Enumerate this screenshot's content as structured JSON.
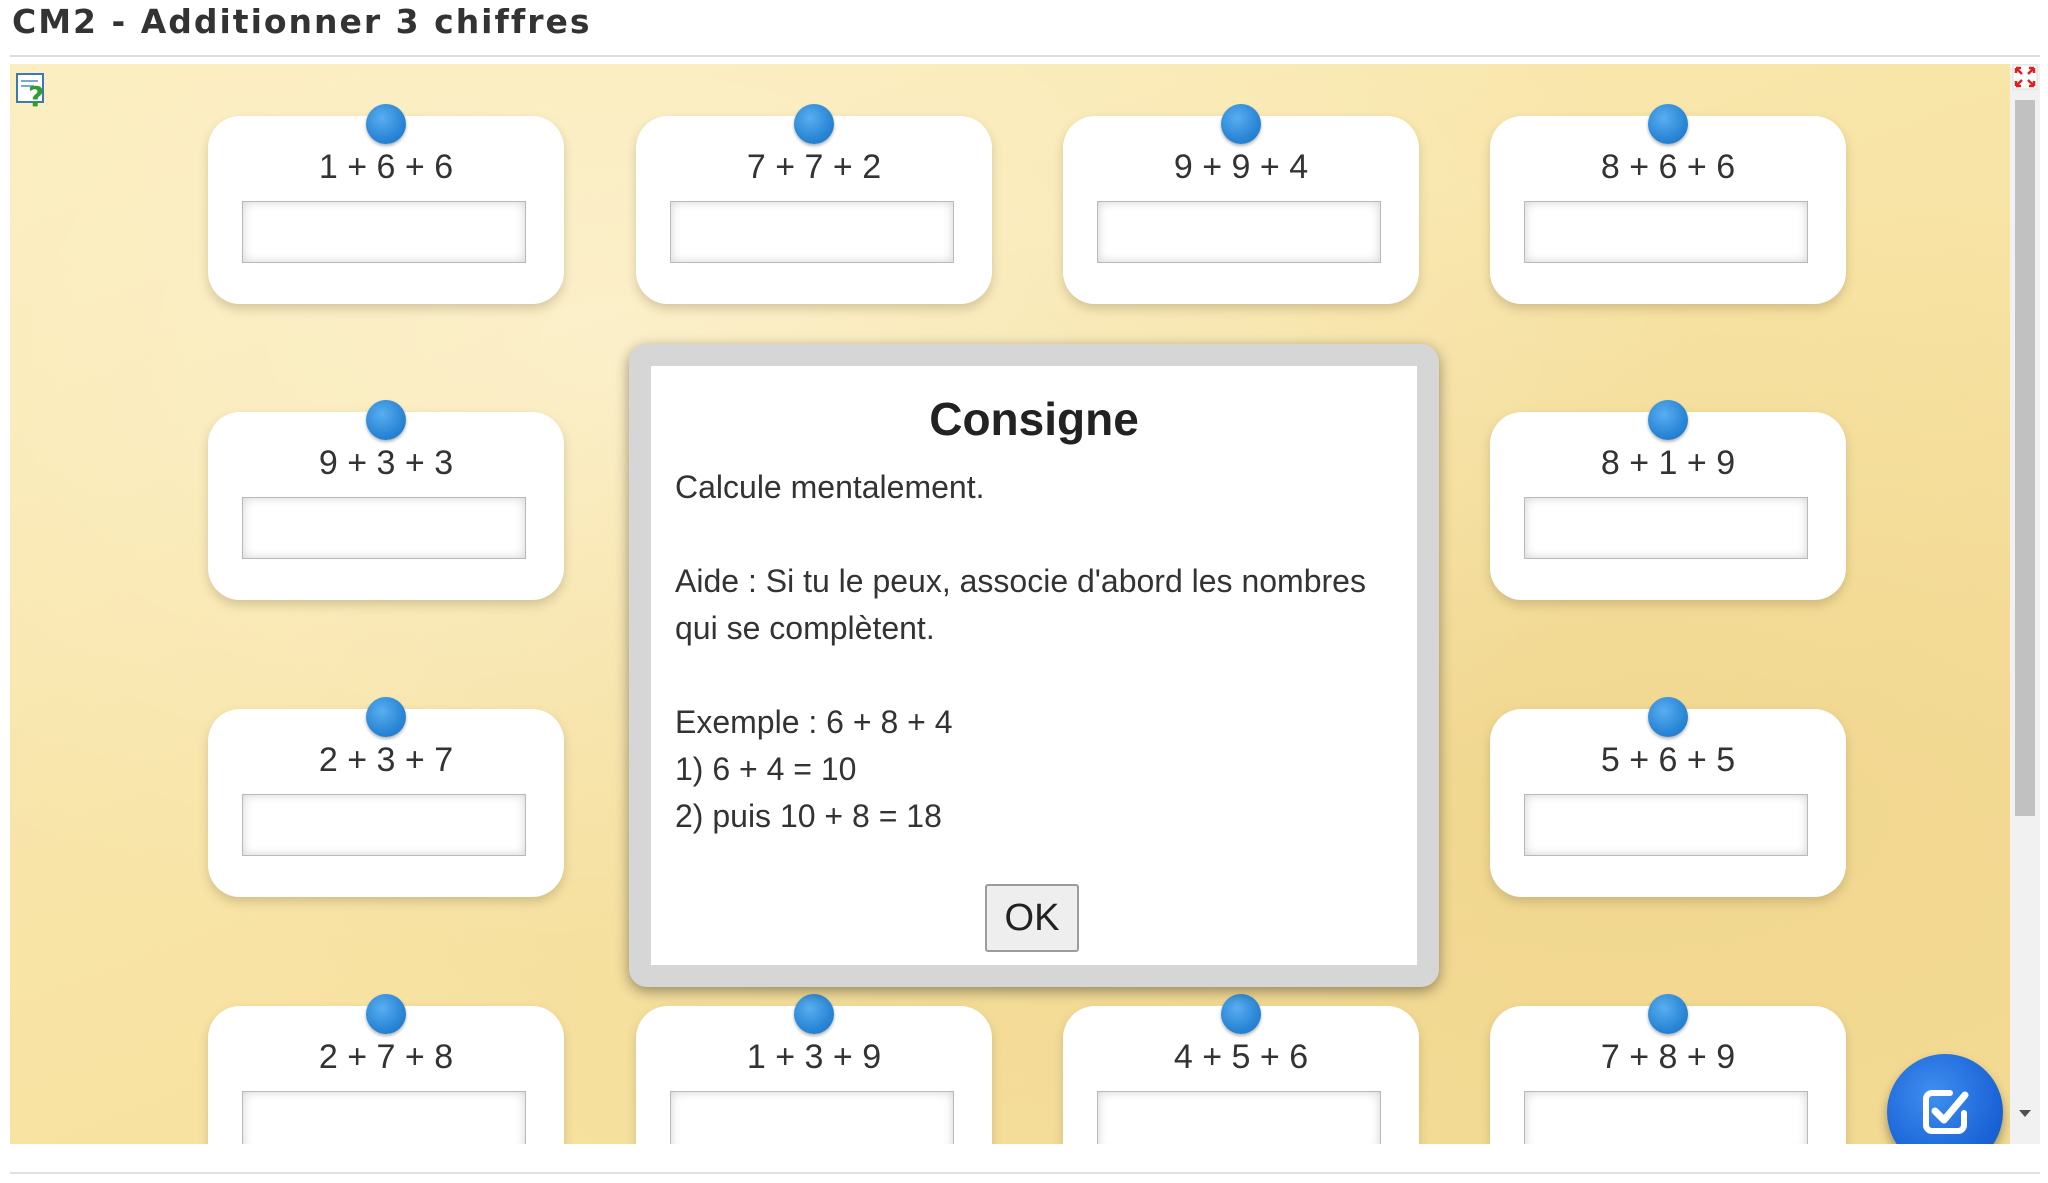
{
  "page": {
    "title": "CM2 - Additionner 3 chiffres"
  },
  "exercises": [
    {
      "expression": "1 + 6 + 6",
      "answer": ""
    },
    {
      "expression": "7 + 7 + 2",
      "answer": ""
    },
    {
      "expression": "9 + 9 + 4",
      "answer": ""
    },
    {
      "expression": "8 + 6 + 6",
      "answer": ""
    },
    {
      "expression": "9 + 3 + 3",
      "answer": ""
    },
    {
      "expression": "8 + 1 + 9",
      "answer": ""
    },
    {
      "expression": "2 + 3 + 7",
      "answer": ""
    },
    {
      "expression": "5 + 6 + 5",
      "answer": ""
    },
    {
      "expression": "2 + 7 + 8",
      "answer": ""
    },
    {
      "expression": "1 + 3 + 9",
      "answer": ""
    },
    {
      "expression": "4 + 5 + 6",
      "answer": ""
    },
    {
      "expression": "7 + 8 + 9",
      "answer": ""
    }
  ],
  "modal": {
    "title": "Consigne",
    "line1": "Calcule mentalement.",
    "line2": "Aide : Si tu le peux, associe d'abord les nombres qui se complètent.",
    "line3": "Exemple : 6 + 8 + 4",
    "line4": "1) 6 + 4 = 10",
    "line5": "2) puis 10 + 8 = 18",
    "ok_label": "OK"
  },
  "icons": {
    "help": "help-icon",
    "fullscreen": "fullscreen-icon",
    "validate": "checkbox-check-icon",
    "scroll_down": "arrow-down-icon"
  },
  "colors": {
    "background": "#f8e4a6",
    "dot": "#2a86d6",
    "validate": "#1a63d6",
    "text": "#333333"
  }
}
